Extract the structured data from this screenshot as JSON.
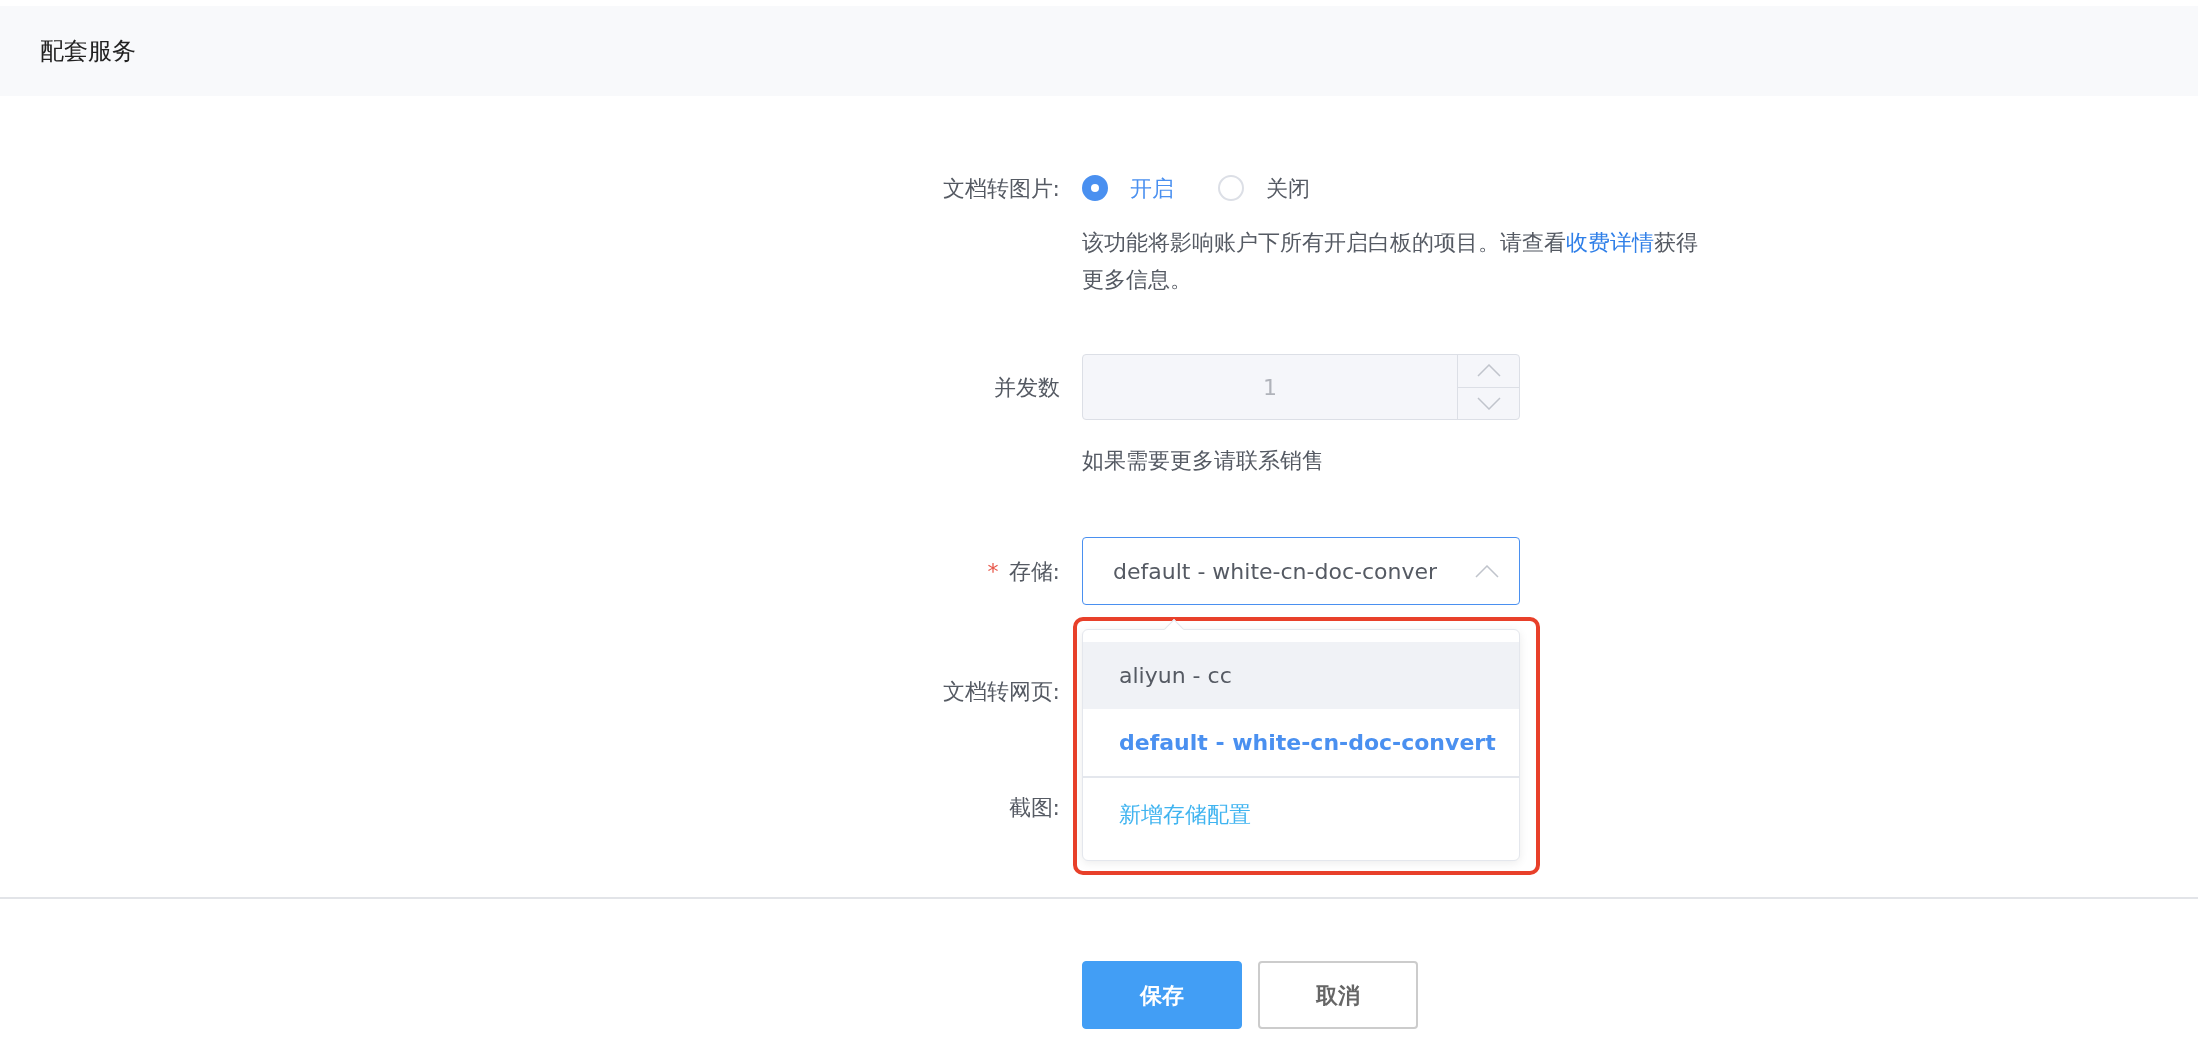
{
  "header": {
    "title": "配套服务"
  },
  "doc_to_image": {
    "label": "文档转图片:",
    "options": [
      {
        "label": "开启",
        "selected": true
      },
      {
        "label": "关闭",
        "selected": false
      }
    ],
    "hint": "该功能将影响账户下所有开启白板的项目。请查看",
    "hint_link": "收费详情",
    "hint_end": "获得更多信息。"
  },
  "concurrency": {
    "label": "并发数",
    "value": "1",
    "disabled": true,
    "hint": "如果需要更多请联系销售"
  },
  "storage": {
    "label": "存储:",
    "required_mark": "*",
    "value": "default - white-cn-doc-conver",
    "expanded": true,
    "options": [
      {
        "kind": "option",
        "label": "aliyun - cc",
        "selected": false,
        "hovered": true
      },
      {
        "kind": "option",
        "label": "default - white-cn-doc-convert",
        "selected": true,
        "hovered": false
      },
      {
        "kind": "action",
        "label": "新增存储配置",
        "selected": false,
        "hovered": false
      }
    ]
  },
  "doc_to_web": {
    "label": "文档转网页:"
  },
  "screenshot": {
    "label": "截图:"
  },
  "buttons": [
    {
      "label": "保存",
      "kind": "primary"
    },
    {
      "label": "取消",
      "kind": "default"
    }
  ]
}
